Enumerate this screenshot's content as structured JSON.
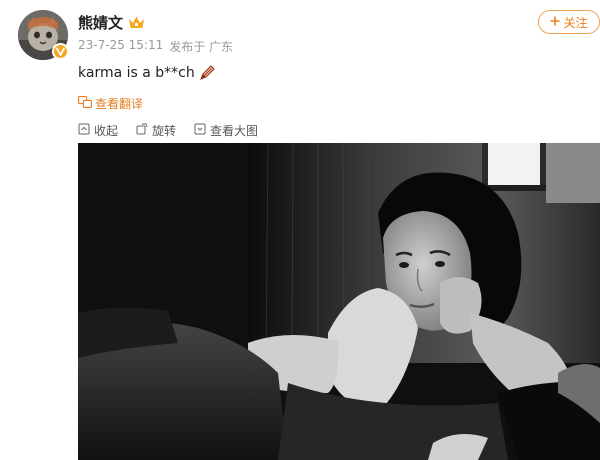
{
  "user": {
    "name": "熊婧文",
    "avatar": "cat-avatar",
    "verified_badge": "verified-icon",
    "badge_color": "#f5a623"
  },
  "post": {
    "date": "23-7-25 15:11",
    "location": "发布于 广东",
    "text": "karma is a b**ch",
    "emoji": "pen-icon"
  },
  "follow_button": {
    "label": "关注",
    "icon": "plus-icon",
    "color": "#f07f1d"
  },
  "translate": {
    "label": "查看翻译",
    "icon": "translate-icon",
    "color": "#e67e22"
  },
  "actions": [
    {
      "label": "收起",
      "icon": "collapse-icon"
    },
    {
      "label": "旋转",
      "icon": "rotate-icon"
    },
    {
      "label": "查看大图",
      "icon": "view-large-icon"
    }
  ],
  "photo": {
    "style": "black-and-white"
  }
}
